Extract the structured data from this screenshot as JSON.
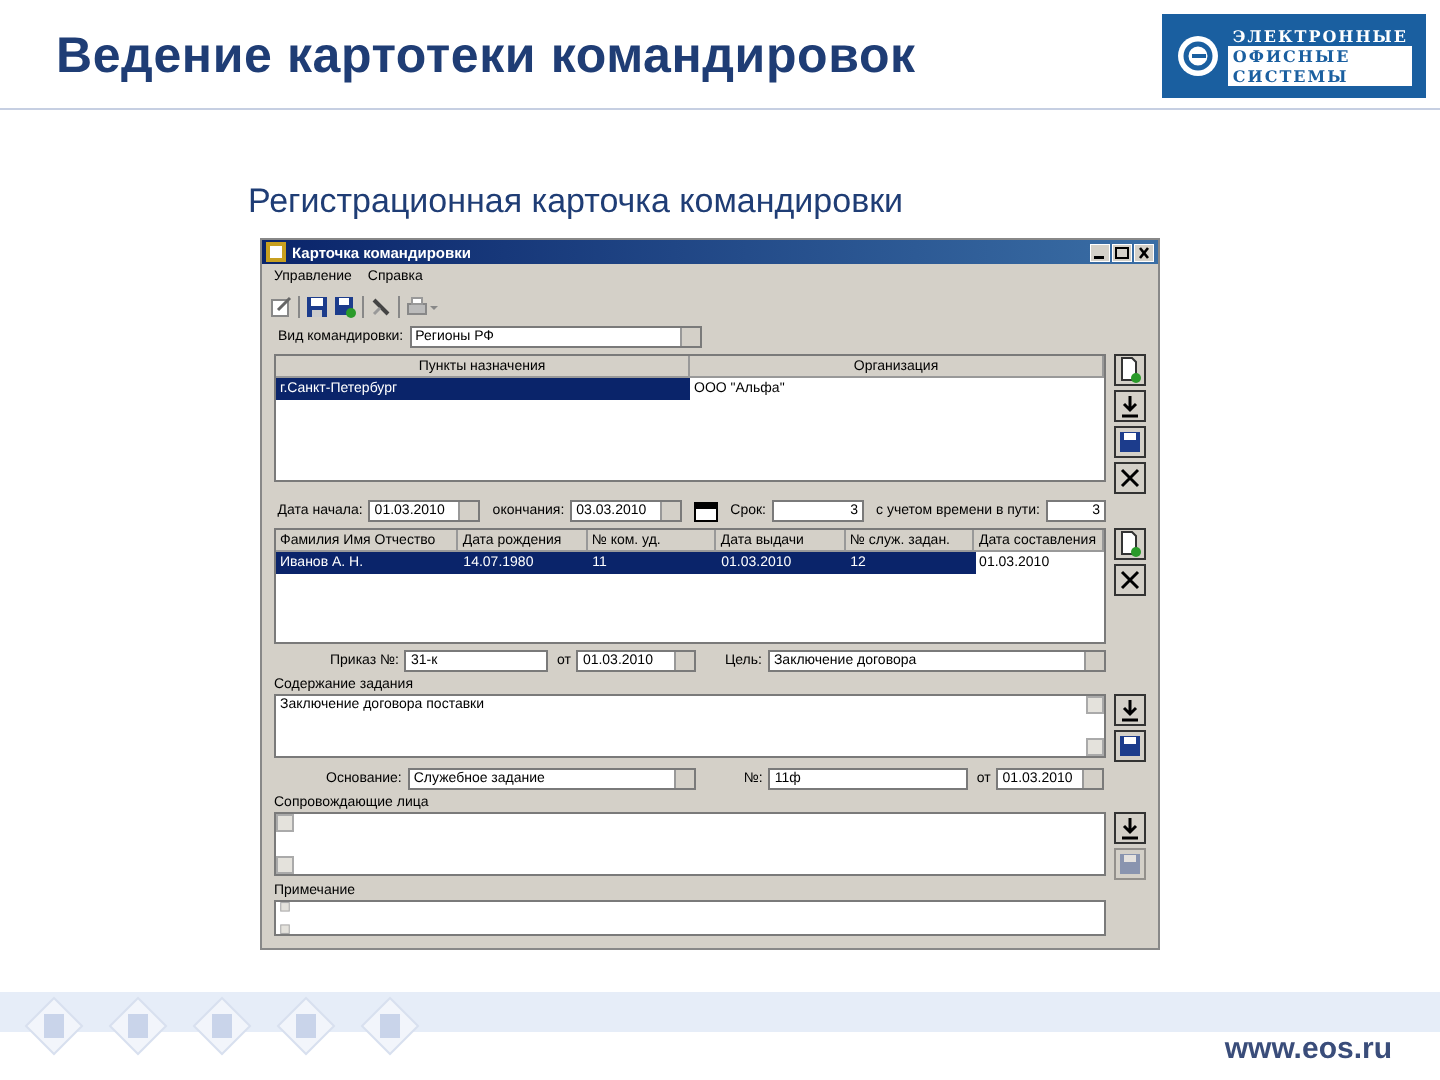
{
  "slide": {
    "title": "Ведение картотеки командировок",
    "subtitle": "Регистрационная карточка командировки",
    "logo": [
      "ЭЛЕКТРОННЫЕ",
      "ОФИСНЫЕ",
      "СИСТЕМЫ"
    ],
    "footer_url": "www.eos.ru"
  },
  "window": {
    "title": "Карточка командировки",
    "menu": [
      "Управление",
      "Справка"
    ]
  },
  "trip_type": {
    "label": "Вид командировки:",
    "value": "Регионы РФ"
  },
  "destinations": {
    "side_buttons": [
      {
        "kind": "add",
        "disabled": false
      },
      {
        "kind": "down",
        "disabled": false
      },
      {
        "kind": "save",
        "disabled": false
      },
      {
        "kind": "delete",
        "disabled": false
      }
    ],
    "columns": [
      "Пункты назначения",
      "Организация"
    ],
    "rows": [
      {
        "cells": [
          {
            "text": "г.Санкт-Петербург",
            "selected": true
          },
          {
            "text": "ООО \"Альфа\"",
            "selected": false
          }
        ]
      }
    ]
  },
  "dates": [
    {
      "label": "Дата начала:",
      "value": "01.03.2010",
      "kind": "date"
    },
    {
      "label": "окончания:",
      "value": "03.03.2010",
      "kind": "date"
    },
    {
      "label": "Срок:",
      "value": "3",
      "kind": "number"
    },
    {
      "label": "с учетом времени в пути:",
      "value": "3",
      "kind": "number"
    }
  ],
  "travelers": {
    "side_buttons": [
      {
        "kind": "add",
        "disabled": false
      },
      {
        "kind": "delete",
        "disabled": false
      }
    ],
    "columns": [
      "Фамилия Имя Отчество",
      "Дата рождения",
      "№ ком. уд.",
      "Дата выдачи",
      "№ служ. задан.",
      "Дата составления"
    ],
    "rows": [
      {
        "cells": [
          {
            "text": "Иванов А. Н.",
            "selected": true
          },
          {
            "text": "14.07.1980",
            "selected": true
          },
          {
            "text": "11",
            "selected": true
          },
          {
            "text": "01.03.2010",
            "selected": true
          },
          {
            "text": "12",
            "selected": true
          },
          {
            "text": "01.03.2010",
            "selected": false
          }
        ]
      }
    ]
  },
  "order_row": [
    {
      "label": "Приказ №:",
      "value": "31-к",
      "kind": "text"
    },
    {
      "label": "от",
      "value": "01.03.2010",
      "kind": "date"
    },
    {
      "label": "Цель:",
      "value": "Заключение договора",
      "kind": "combo"
    }
  ],
  "task": {
    "label": "Содержание задания",
    "value": "Заключение договора поставки",
    "side_buttons": [
      {
        "kind": "down",
        "disabled": false
      },
      {
        "kind": "save",
        "disabled": false
      }
    ]
  },
  "basis_row": [
    {
      "label": "Основание:",
      "value": "Служебное задание",
      "kind": "combo"
    },
    {
      "label": "№:",
      "value": "11ф",
      "kind": "text"
    },
    {
      "label": "от",
      "value": "01.03.2010",
      "kind": "date"
    }
  ],
  "companions": {
    "label": "Сопровождающие лица",
    "side_buttons": [
      {
        "kind": "down",
        "disabled": false
      },
      {
        "kind": "save",
        "disabled": true
      }
    ]
  },
  "notes": {
    "label": "Примечание"
  }
}
